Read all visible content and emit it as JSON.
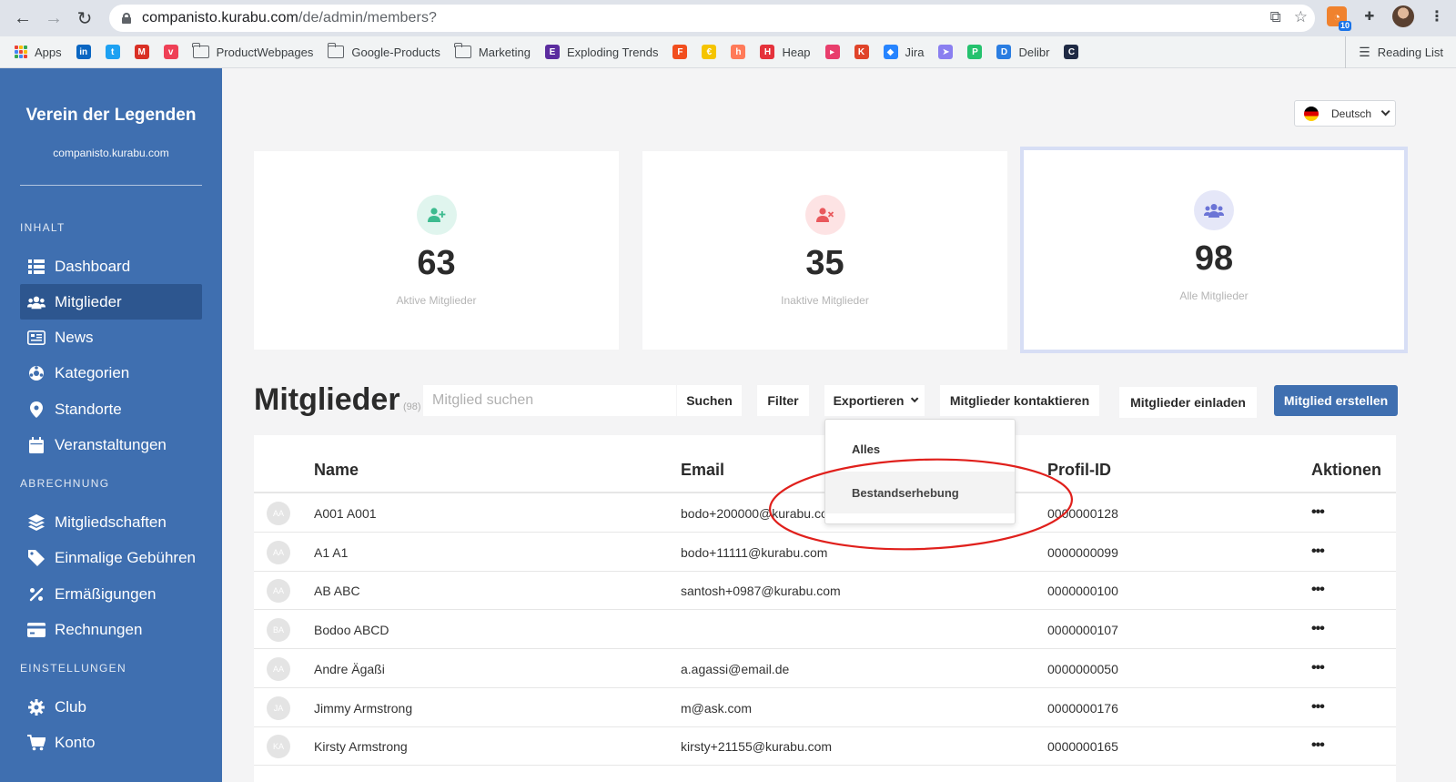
{
  "browser": {
    "url_domain": "companisto.kurabu.com",
    "url_path": "/de/admin/members?",
    "ext_badge": "10",
    "bookmarks": [
      {
        "label": "Apps",
        "icon": "apps-grid-icon"
      },
      {
        "label": "",
        "icon": "linkedin-icon",
        "color": "#0a66c2",
        "glyph": "in"
      },
      {
        "label": "",
        "icon": "twitter-icon",
        "color": "#1da1f2",
        "glyph": "t"
      },
      {
        "label": "",
        "icon": "gmail-icon",
        "color": "#d93025",
        "glyph": "M"
      },
      {
        "label": "",
        "icon": "pocket-icon",
        "color": "#ef4056",
        "glyph": "v"
      },
      {
        "label": "ProductWebpages",
        "icon": "folder-icon"
      },
      {
        "label": "Google-Products",
        "icon": "folder-icon"
      },
      {
        "label": "Marketing",
        "icon": "folder-icon"
      },
      {
        "label": "Exploding Trends",
        "icon": "exploding-trends-icon",
        "color": "#5b2c9f",
        "glyph": "E"
      },
      {
        "label": "",
        "icon": "figma-icon",
        "color": "#f24e1e",
        "glyph": "F"
      },
      {
        "label": "",
        "icon": "euro-icon",
        "color": "#f5c400",
        "glyph": "€"
      },
      {
        "label": "",
        "icon": "hubspot-icon",
        "color": "#ff7a59",
        "glyph": "h"
      },
      {
        "label": "Heap",
        "icon": "heap-icon",
        "color": "#e5323b",
        "glyph": "H"
      },
      {
        "label": "",
        "icon": "video-icon",
        "color": "#e83e6c",
        "glyph": "▸"
      },
      {
        "label": "",
        "icon": "k-icon",
        "color": "#e0442a",
        "glyph": "K"
      },
      {
        "label": "Jira",
        "icon": "jira-icon",
        "color": "#2684ff",
        "glyph": "◆"
      },
      {
        "label": "",
        "icon": "send-icon",
        "color": "#8a7ff0",
        "glyph": "➤"
      },
      {
        "label": "",
        "icon": "p-icon",
        "color": "#25c26e",
        "glyph": "P"
      },
      {
        "label": "Delibr",
        "icon": "delibr-icon",
        "color": "#2a7de1",
        "glyph": "D"
      },
      {
        "label": "",
        "icon": "c-icon",
        "color": "#1f2a44",
        "glyph": "C"
      }
    ],
    "reading_list": "Reading List"
  },
  "sidebar": {
    "club_name": "Verein der Legenden",
    "club_domain": "companisto.kurabu.com",
    "sections": [
      {
        "title": "INHALT",
        "items": [
          {
            "label": "Dashboard",
            "icon": "dashboard-icon"
          },
          {
            "label": "Mitglieder",
            "icon": "members-icon",
            "active": true
          },
          {
            "label": "News",
            "icon": "news-icon"
          },
          {
            "label": "Kategorien",
            "icon": "categories-icon"
          },
          {
            "label": "Standorte",
            "icon": "location-icon"
          },
          {
            "label": "Veranstaltungen",
            "icon": "calendar-icon"
          }
        ]
      },
      {
        "title": "ABRECHNUNG",
        "items": [
          {
            "label": "Mitgliedschaften",
            "icon": "layers-icon"
          },
          {
            "label": "Einmalige Gebühren",
            "icon": "tag-icon"
          },
          {
            "label": "Ermäßigungen",
            "icon": "percent-icon"
          },
          {
            "label": "Rechnungen",
            "icon": "credit-card-icon"
          }
        ]
      },
      {
        "title": "EINSTELLUNGEN",
        "items": [
          {
            "label": "Club",
            "icon": "gear-icon"
          },
          {
            "label": "Konto",
            "icon": "cart-icon"
          }
        ]
      }
    ]
  },
  "language": {
    "selected": "Deutsch"
  },
  "stats": [
    {
      "value": "63",
      "label": "Aktive Mitglieder",
      "icon": "user-plus-icon",
      "color": "#3dbb8f",
      "bg": "#e0f5ee"
    },
    {
      "value": "35",
      "label": "Inaktive Mitglieder",
      "icon": "user-times-icon",
      "color": "#e9585c",
      "bg": "#fde3e4"
    },
    {
      "value": "98",
      "label": "Alle Mitglieder",
      "icon": "users-icon",
      "color": "#6b74d6",
      "bg": "#e5e7f8"
    }
  ],
  "members": {
    "title": "Mitglieder",
    "count": "(98)",
    "search_placeholder": "Mitglied suchen",
    "buttons": {
      "search": "Suchen",
      "filter": "Filter",
      "export": "Exportieren",
      "contact": "Mitglieder kontaktieren",
      "invite": "Mitglieder einladen",
      "create": "Mitglied erstellen"
    },
    "export_menu": [
      "Alles",
      "Bestandserhebung"
    ],
    "columns": {
      "name": "Name",
      "email": "Email",
      "profile_id": "Profil-ID",
      "actions": "Aktionen"
    },
    "rows": [
      {
        "initials": "AA",
        "name": "A001 A001",
        "email": "bodo+200000@kurabu.com",
        "profile_id": "0000000128"
      },
      {
        "initials": "AA",
        "name": "A1 A1",
        "email": "bodo+11111@kurabu.com",
        "profile_id": "0000000099"
      },
      {
        "initials": "AA",
        "name": "AB ABC",
        "email": "santosh+0987@kurabu.com",
        "profile_id": "0000000100"
      },
      {
        "initials": "BA",
        "name": "Bodoo ABCD",
        "email": "",
        "profile_id": "0000000107"
      },
      {
        "initials": "AA",
        "name": "Andre Ägaßi",
        "email": "a.agassi@email.de",
        "profile_id": "0000000050"
      },
      {
        "initials": "JA",
        "name": "Jimmy Armstrong",
        "email": "m@ask.com",
        "profile_id": "0000000176"
      },
      {
        "initials": "KA",
        "name": "Kirsty Armstrong",
        "email": "kirsty+21155@kurabu.com",
        "profile_id": "0000000165"
      }
    ]
  },
  "colors": {
    "sidebar": "#3f6fb0",
    "sidebar_active": "#2d568f",
    "primary": "#3f6fb0",
    "annotation": "#e0201c"
  }
}
